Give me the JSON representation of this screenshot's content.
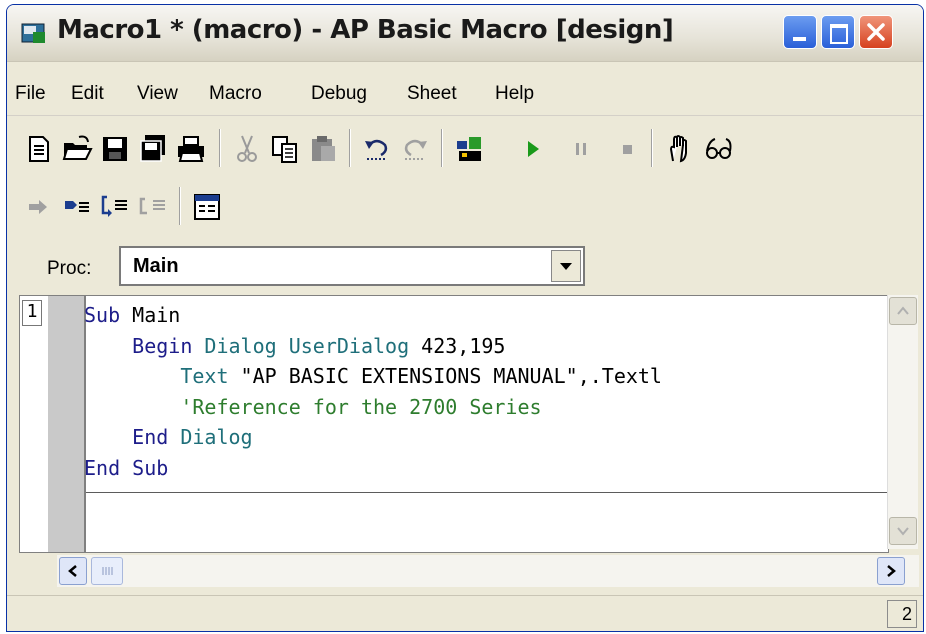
{
  "window": {
    "title": "Macro1 * (macro) - AP Basic Macro [design]"
  },
  "menu": {
    "items": [
      "File",
      "Edit",
      "View",
      "Macro",
      "Debug",
      "Sheet",
      "Help"
    ]
  },
  "toolbar1": {
    "icons": [
      "new-file-icon",
      "open-folder-icon",
      "save-icon",
      "save-all-icon",
      "print-icon",
      "cut-icon",
      "copy-icon",
      "paste-icon",
      "undo-icon",
      "redo-icon",
      "edit-dialog-icon",
      "run-icon",
      "pause-icon",
      "stop-icon",
      "hand-icon",
      "watch-icon"
    ]
  },
  "toolbar2": {
    "icons": [
      "step-arrow-icon",
      "step-into-icon",
      "step-over-icon",
      "step-out-icon",
      "dialog-form-icon"
    ]
  },
  "proc": {
    "label": "Proc:",
    "value": "Main"
  },
  "editor": {
    "line_number": "1",
    "lines": [
      [
        {
          "t": "Sub",
          "c": "kw"
        },
        {
          "t": " Main",
          "c": "plain"
        }
      ],
      [
        {
          "t": "    Begin",
          "c": "kw"
        },
        {
          "t": " Dialog",
          "c": "id"
        },
        {
          "t": " UserDialog",
          "c": "id"
        },
        {
          "t": " 423,195",
          "c": "plain"
        }
      ],
      [
        {
          "t": "        Text",
          "c": "id"
        },
        {
          "t": " \"AP BASIC EXTENSIONS MANUAL\",.Textl",
          "c": "plain"
        }
      ],
      [
        {
          "t": "        'Reference for the 2700 Series",
          "c": "cm"
        }
      ],
      [
        {
          "t": "    End",
          "c": "kw"
        },
        {
          "t": " Dialog",
          "c": "id"
        }
      ],
      [
        {
          "t": "End",
          "c": "kw"
        },
        {
          "t": " Sub",
          "c": "kw"
        }
      ]
    ]
  },
  "status": {
    "value": "2"
  },
  "colors": {
    "keyword": "#1d1d8a",
    "identifier": "#1f6f7a",
    "comment": "#2e7d2e",
    "run_green": "#1a9a1a"
  }
}
